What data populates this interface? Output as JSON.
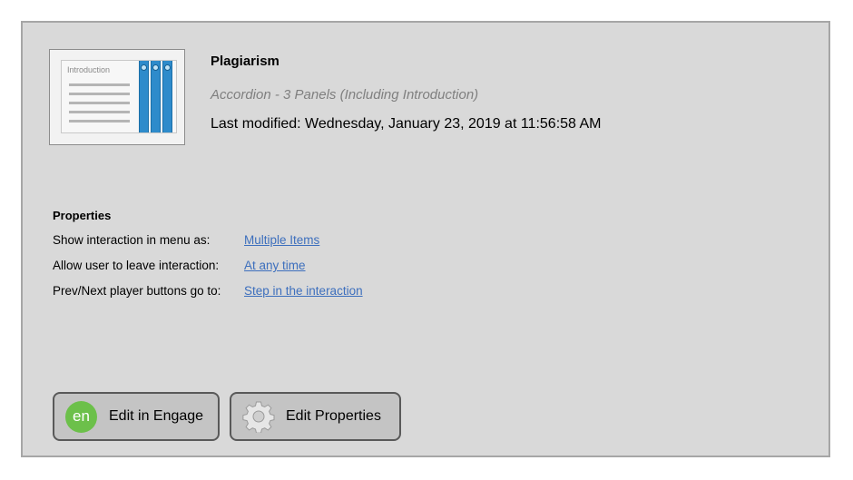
{
  "item": {
    "title": "Plagiarism",
    "type": "Accordion - 3 Panels (Including Introduction)",
    "last_modified": "Last modified: Wednesday, January 23, 2019 at 11:56:58 AM",
    "thumbnail": {
      "heading": "Introduction",
      "tab_color": "#2e8bcb"
    }
  },
  "properties": {
    "heading": "Properties",
    "rows": [
      {
        "label": "Show interaction in menu as:",
        "value": "Multiple Items"
      },
      {
        "label": "Allow user to leave interaction:",
        "value": "At any time"
      },
      {
        "label": "Prev/Next player buttons go to:",
        "value": "Step in the interaction"
      }
    ]
  },
  "buttons": {
    "engage": {
      "label": "Edit in Engage",
      "icon_text": "en",
      "icon_color": "#6cc04a"
    },
    "properties": {
      "label": "Edit Properties",
      "icon": "gear-icon"
    }
  }
}
